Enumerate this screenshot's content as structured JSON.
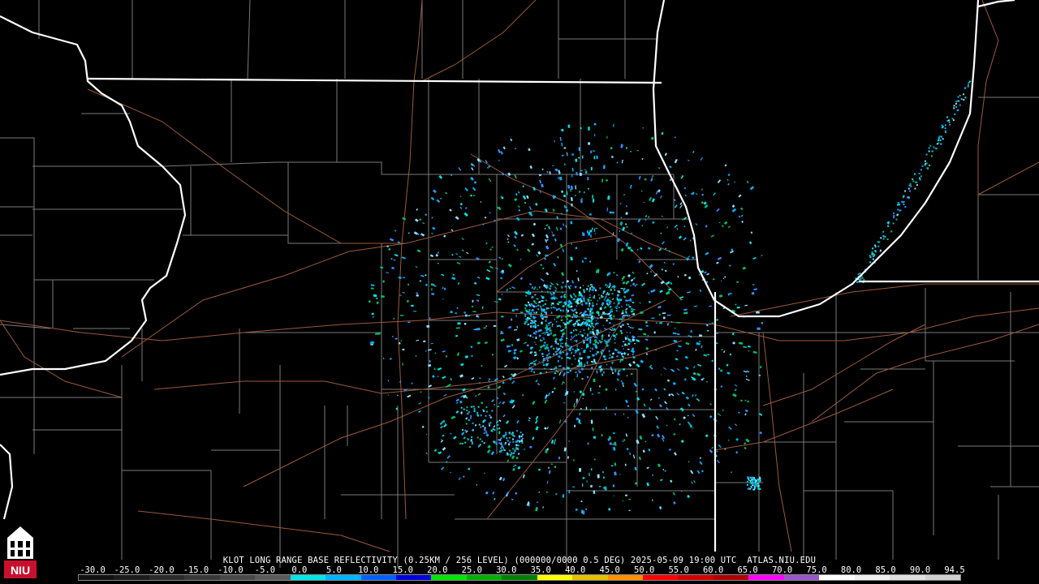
{
  "caption": {
    "text": "KLOT LONG RANGE BASE REFLECTIVITY (0.25KM / 256 LEVEL) (000000/0000 0.5 DEG) 2025-05-09 19:00 UTC  ATLAS.NIU.EDU"
  },
  "colorbar": {
    "labels": [
      "-30.0",
      "-25.0",
      "-20.0",
      "-15.0",
      "-10.0",
      "-5.0",
      "0.0",
      "5.0",
      "10.0",
      "15.0",
      "20.0",
      "25.0",
      "30.0",
      "35.0",
      "40.0",
      "45.0",
      "50.0",
      "55.0",
      "60.0",
      "65.0",
      "70.0",
      "75.0",
      "80.0",
      "85.0",
      "90.0",
      "94.5"
    ],
    "colors": [
      "#101010",
      "#1c1c1c",
      "#2a2a2a",
      "#383838",
      "#484848",
      "#5a5a5a",
      "#00e5e5",
      "#00b4ff",
      "#0060ff",
      "#0000e0",
      "#00e600",
      "#00b000",
      "#008000",
      "#ffff00",
      "#e6c000",
      "#ff9000",
      "#ff0000",
      "#d40000",
      "#b00000",
      "#ff00ff",
      "#9955cc",
      "#ffffff",
      "#f0f0f0",
      "#e0e0e0",
      "#d0d0d0"
    ]
  },
  "logo": {
    "text": "NIU",
    "bg_color": "#c8102e"
  },
  "map": {
    "state_line_color": "#ffffff",
    "county_line_color": "#808080",
    "highway_color": "#a0522d",
    "echo_colors": [
      "#00b4ff",
      "#00e5e5",
      "#3a8cff",
      "#8ce0ff",
      "#00c070"
    ]
  }
}
